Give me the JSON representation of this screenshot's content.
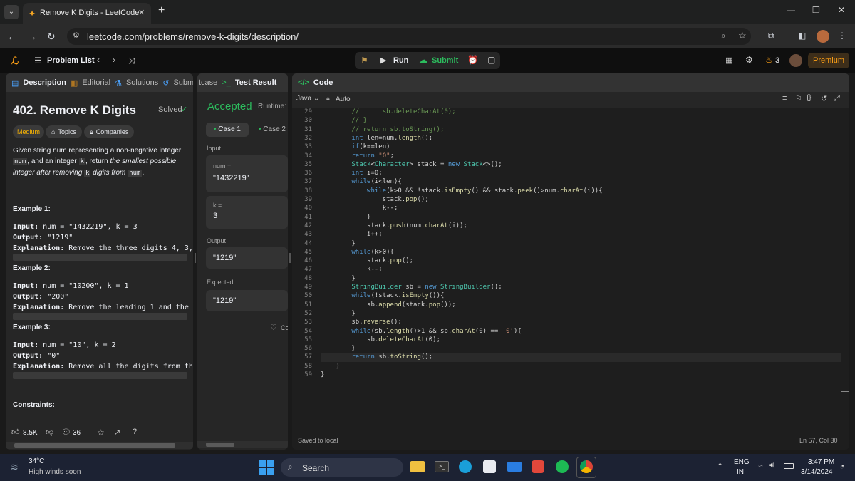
{
  "browser": {
    "tab_title": "Remove K Digits - LeetCode",
    "url": "leetcode.com/problems/remove-k-digits/description/"
  },
  "header": {
    "problem_list": "Problem List",
    "run": "Run",
    "submit": "Submit",
    "streak": "3",
    "premium": "Premium"
  },
  "left": {
    "tabs": [
      "Description",
      "Editorial",
      "Solutions",
      "Subm"
    ],
    "title": "402. Remove K Digits",
    "solved": "Solved",
    "difficulty": "Medium",
    "topics": "Topics",
    "companies": "Companies",
    "desc1": "Given string num representing a non-negative integer",
    "code_num": "num",
    "desc2": ", and an integer",
    "code_k": "k",
    "desc3": ", return",
    "desc3i": "the smallest possible",
    "desc4i": "integer after removing",
    "desc4i2": "digits from",
    "ex1_title": "Example 1:",
    "ex1_in_l": "Input:",
    "ex1_in": "num = \"1432219\", k = 3",
    "ex1_out_l": "Output:",
    "ex1_out": "\"1219\"",
    "ex1_exp_l": "Explanation:",
    "ex1_exp": "Remove the three digits 4, 3,",
    "ex2_title": "Example 2:",
    "ex2_in": "num = \"10200\", k = 1",
    "ex2_out": "\"200\"",
    "ex2_exp": "Remove the leading 1 and the",
    "ex3_title": "Example 3:",
    "ex3_in": "num = \"10\", k = 2",
    "ex3_out": "\"0\"",
    "ex3_exp": "Remove all the digits from th",
    "constraints": "Constraints:",
    "likes": "8.5K",
    "comments": "36"
  },
  "mid": {
    "tab1": "tcase",
    "tab2": "Test Result",
    "status": "Accepted",
    "runtime": "Runtime:",
    "case1": "Case 1",
    "case2": "Case 2",
    "input_label": "Input",
    "var1": "num =",
    "val1": "\"1432219\"",
    "var2": "k =",
    "val2": "3",
    "output_label": "Output",
    "output": "\"1219\"",
    "expected_label": "Expected",
    "expected": "\"1219\"",
    "contrib": "Co"
  },
  "code": {
    "title": "Code",
    "lang": "Java",
    "auto": "Auto",
    "saved": "Saved to local",
    "cursor": "Ln 57, Col 30",
    "lines": [
      {
        "n": "29",
        "t": "        //      sb.deleteCharAt(0);"
      },
      {
        "n": "30",
        "t": "        // }"
      },
      {
        "n": "31",
        "t": "        // return sb.toString();"
      },
      {
        "n": "32",
        "t": "        int len=num.length();"
      },
      {
        "n": "33",
        "t": "        if(k==len)"
      },
      {
        "n": "34",
        "t": "        return \"0\";"
      },
      {
        "n": "35",
        "t": "        Stack<Character> stack = new Stack<>();"
      },
      {
        "n": "36",
        "t": "        int i=0;"
      },
      {
        "n": "37",
        "t": "        while(i<len){"
      },
      {
        "n": "38",
        "t": "            while(k>0 && !stack.isEmpty() && stack.peek()>num.charAt(i)){"
      },
      {
        "n": "39",
        "t": "                stack.pop();"
      },
      {
        "n": "40",
        "t": "                k--;"
      },
      {
        "n": "41",
        "t": "            }"
      },
      {
        "n": "42",
        "t": "            stack.push(num.charAt(i));"
      },
      {
        "n": "43",
        "t": "            i++;"
      },
      {
        "n": "44",
        "t": "        }"
      },
      {
        "n": "45",
        "t": "        while(k>0){"
      },
      {
        "n": "46",
        "t": "            stack.pop();"
      },
      {
        "n": "47",
        "t": "            k--;"
      },
      {
        "n": "48",
        "t": "        }"
      },
      {
        "n": "49",
        "t": "        StringBuilder sb = new StringBuilder();"
      },
      {
        "n": "50",
        "t": "        while(!stack.isEmpty()){"
      },
      {
        "n": "51",
        "t": "            sb.append(stack.pop());"
      },
      {
        "n": "52",
        "t": "        }"
      },
      {
        "n": "53",
        "t": "        sb.reverse();"
      },
      {
        "n": "54",
        "t": "        while(sb.length()>1 && sb.charAt(0) == '0'){"
      },
      {
        "n": "55",
        "t": "            sb.deleteCharAt(0);"
      },
      {
        "n": "56",
        "t": "        }"
      },
      {
        "n": "57",
        "t": "        return sb.toString();"
      },
      {
        "n": "58",
        "t": "    }"
      },
      {
        "n": "59",
        "t": "}"
      }
    ]
  },
  "taskbar": {
    "temp": "34°C",
    "weather": "High winds soon",
    "search": "Search",
    "lang1": "ENG",
    "lang2": "IN",
    "time": "3:47 PM",
    "date": "3/14/2024"
  }
}
